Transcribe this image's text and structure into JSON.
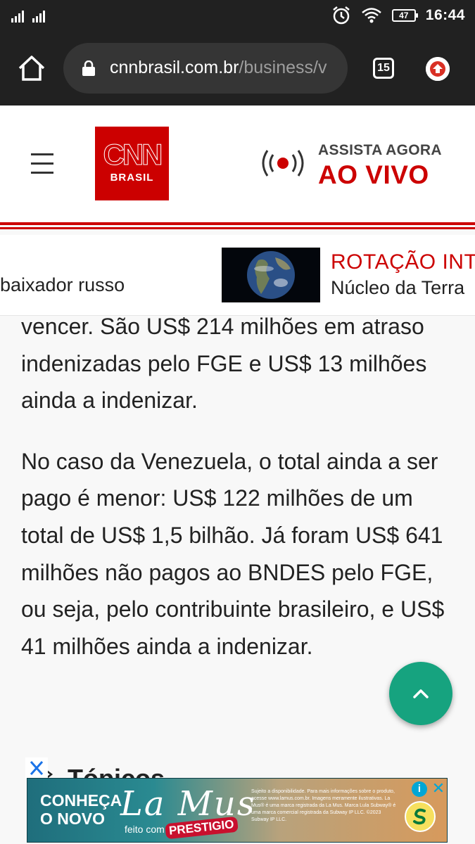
{
  "status_bar": {
    "time": "16:44",
    "battery": "47",
    "icons": [
      "signal-icon",
      "signal-icon",
      "alarm-icon",
      "wifi-icon",
      "battery-icon"
    ]
  },
  "browser": {
    "url_domain": "cnnbrasil.com.br",
    "url_path": "/business/v",
    "tab_count": "15",
    "icons": [
      "home-icon",
      "lock-icon",
      "tabs-icon",
      "update-icon"
    ]
  },
  "header": {
    "logo_word": "CNN",
    "logo_sub": "BRASIL",
    "assista": "ASSISTA AGORA",
    "aovivo": "AO VIVO",
    "brand_color": "#cc0000"
  },
  "ticker": {
    "left_text": "baixador russo",
    "title": "ROTAÇÃO INTE",
    "subtitle": "Núcleo da Terra"
  },
  "article": {
    "paragraphs": [
      "vencer. São US$ 214 milhões em atraso indenizadas pelo FGE e US$ 13 milhões ainda a indenizar.",
      "No caso da Venezuela, o total ainda a ser pago é menor: US$ 122 milhões de um total de US$ 1,5 bilhão. Já foram US$ 641 milhões não pagos ao BNDES pelo FGE, ou seja, pelo contribuinte brasileiro, e US$ 41 milhões ainda a indenizar."
    ],
    "topicos": "Tópicos"
  },
  "ad": {
    "headline": "CONHEÇA O NOVO",
    "brand": "La Mus",
    "feito_com": "feito com",
    "prestigio": "PRESTIGIO",
    "fine_print": "Sujeito a disponibilidade. Para mais informações sobre o produto, acesse www.lamus.com.br. Imagens meramente ilustrativas. La Mus® é uma marca registrada da La Mus. Marca Lula Subway® é uma marca comercial registrada da Subway IP LLC. ©2023 Subway IP LLC.",
    "info": "i",
    "close": "✕",
    "accent": "#00a6d6"
  }
}
